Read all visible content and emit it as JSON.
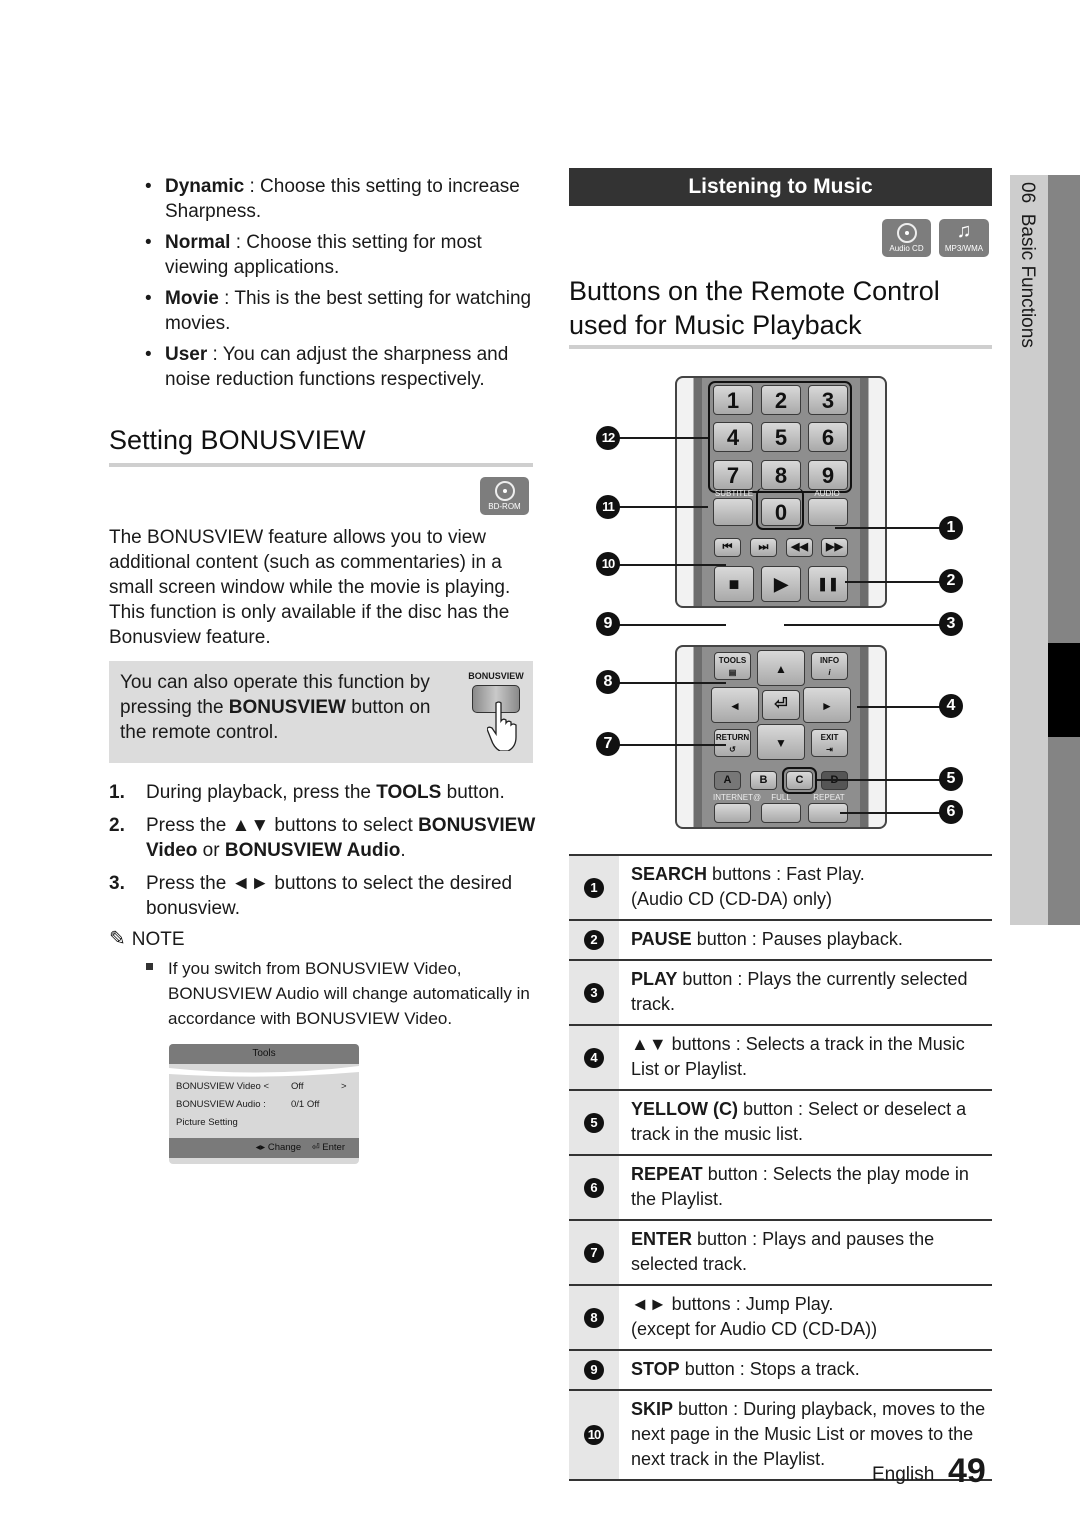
{
  "sharpness_options": [
    {
      "term": "Dynamic",
      "text": " : Choose this setting to increase Sharpness."
    },
    {
      "term": "Normal",
      "text": " : Choose this setting for most viewing applications."
    },
    {
      "term": "Movie",
      "text": " : This is the best setting for watching movies."
    },
    {
      "term": "User",
      "text": " : You can adjust the sharpness and noise reduction functions respectively."
    }
  ],
  "bonusview": {
    "title": "Setting BONUSVIEW",
    "disc_badge": "BD-ROM",
    "description": "The BONUSVIEW feature allows you to view additional content (such as commentaries) in a small screen window while the movie is playing. This function is only available if the disc has the Bonusview feature.",
    "tip": {
      "before": "You can also operate this function by pressing the ",
      "bold": "BONUSVIEW",
      "after": " button on the remote control.",
      "button_label": "BONUSVIEW"
    },
    "steps": [
      {
        "num": "1.",
        "parts": [
          {
            "t": "During playback, press the "
          },
          {
            "t": "TOOLS",
            "b": true
          },
          {
            "t": " button."
          }
        ]
      },
      {
        "num": "2.",
        "parts": [
          {
            "t": "Press the ▲▼ buttons to select "
          },
          {
            "t": "BONUSVIEW Video",
            "b": true
          },
          {
            "t": " or "
          },
          {
            "t": "BONUSVIEW Audio",
            "b": true
          },
          {
            "t": "."
          }
        ]
      },
      {
        "num": "3.",
        "parts": [
          {
            "t": "Press the ◄► buttons to select the desired bonusview."
          }
        ]
      }
    ],
    "note_heading": "NOTE",
    "note_text": "If you switch from BONUSVIEW Video, BONUSVIEW Audio will change automatically in accordance with BONUSVIEW Video.",
    "osd": {
      "title": "Tools",
      "rows": [
        {
          "label": "BONUSVIEW Video <",
          "value": "Off",
          "arrow": ">"
        },
        {
          "label": "BONUSVIEW Audio :",
          "value": "0/1 Off",
          "arrow": ""
        },
        {
          "label": "Picture Setting",
          "value": "",
          "arrow": ""
        }
      ],
      "footer_change": "◂▸ Change",
      "footer_enter": "⏎ Enter"
    }
  },
  "music": {
    "banner": "Listening to Music",
    "badges": [
      "Audio CD",
      "MP3/WMA"
    ],
    "title_line1": "Buttons on the Remote Control",
    "title_line2": "used for Music Playback",
    "remote": {
      "numbers": [
        "1",
        "2",
        "3",
        "4",
        "5",
        "6",
        "7",
        "8",
        "9",
        "0"
      ],
      "subtitle_label": "SUBTITLE",
      "audio_label": "AUDIO",
      "transport": [
        "⏮",
        "⏭",
        "◀◀",
        "▶▶"
      ],
      "stop": "■",
      "play": "▶",
      "pause": "❚❚",
      "tools": "TOOLS",
      "info": "INFO",
      "return": "RETURN",
      "exit": "EXIT",
      "up": "▲",
      "down": "▼",
      "left": "◄",
      "right": "►",
      "enter": "⏎",
      "color_buttons": [
        "A",
        "B",
        "C",
        "D"
      ],
      "bottom_labels": [
        "INTERNET@",
        "FULL SCREEN",
        "REPEAT"
      ]
    },
    "callouts_left": [
      "12",
      "11",
      "10",
      "9",
      "8",
      "7"
    ],
    "callouts_right": [
      "1",
      "2",
      "3",
      "4",
      "5",
      "6"
    ],
    "table": [
      {
        "num": "1",
        "bold": "SEARCH",
        "text": " buttons : Fast Play.",
        "line2": "(Audio CD (CD-DA) only)"
      },
      {
        "num": "2",
        "bold": "PAUSE",
        "text": " button : Pauses playback.",
        "line2": ""
      },
      {
        "num": "3",
        "bold": "PLAY",
        "text": " button : Plays the currently selected track.",
        "line2": ""
      },
      {
        "num": "4",
        "bold": "▲▼",
        "text": " buttons : Selects a track in the Music List or Playlist.",
        "line2": ""
      },
      {
        "num": "5",
        "bold": "YELLOW (C)",
        "text": " button : Select or deselect a track in the music list.",
        "line2": ""
      },
      {
        "num": "6",
        "bold": "REPEAT",
        "text": " button : Selects the play mode in the Playlist.",
        "line2": ""
      },
      {
        "num": "7",
        "bold": "ENTER",
        "text": " button : Plays and pauses the selected track.",
        "line2": ""
      },
      {
        "num": "8",
        "bold": "◄►",
        "text": " buttons : Jump Play.",
        "line2": "(except for Audio CD (CD-DA))"
      },
      {
        "num": "9",
        "bold": "STOP",
        "text": " button : Stops a track.",
        "line2": ""
      },
      {
        "num": "10",
        "bold": "SKIP",
        "text": " button : During playback, moves to the next page in the Music List or moves to the next track in the Playlist.",
        "line2": ""
      }
    ]
  },
  "side_tab": {
    "chapter": "06",
    "title": "Basic Functions"
  },
  "footer": {
    "language": "English",
    "page": "49"
  }
}
